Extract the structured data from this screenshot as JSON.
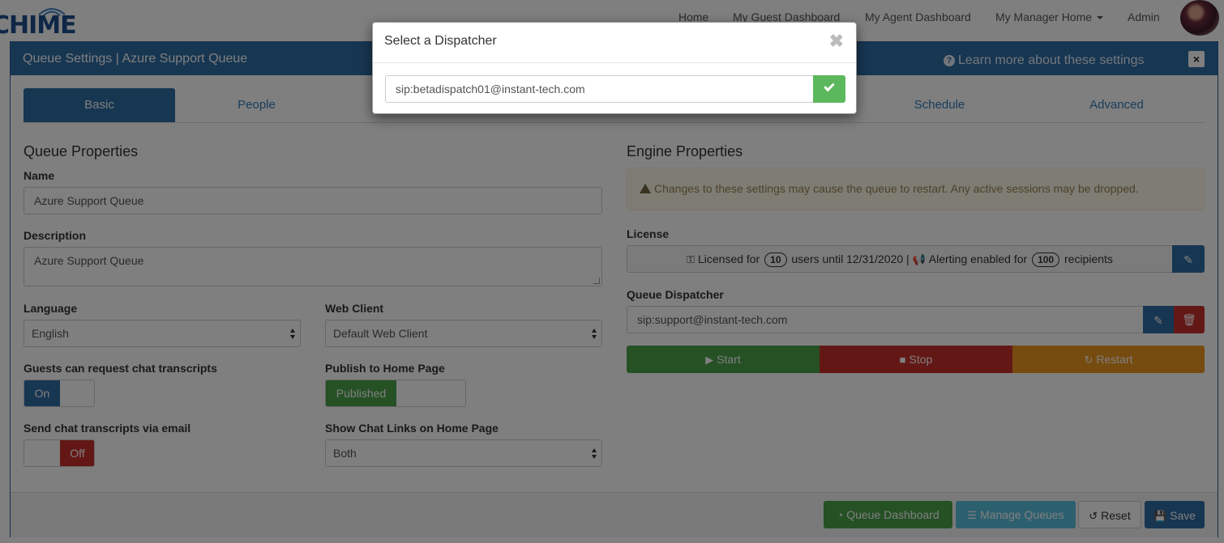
{
  "brand": {
    "logo_text": "CHIME"
  },
  "nav": {
    "links": [
      "Home",
      "My Guest Dashboard",
      "My Agent Dashboard",
      "My Manager Home",
      "Admin"
    ]
  },
  "panel": {
    "title": "Queue Settings | Azure Support Queue",
    "learn_more": "Learn more about these settings",
    "close": "×"
  },
  "tabs": [
    "Basic",
    "People",
    "Schedule",
    "Advanced"
  ],
  "queue": {
    "section_title": "Queue Properties",
    "name_label": "Name",
    "name_value": "Azure Support Queue",
    "description_label": "Description",
    "description_value": "Azure Support Queue",
    "language_label": "Language",
    "language_value": "English",
    "web_client_label": "Web Client",
    "web_client_value": "Default Web Client",
    "transcripts_label": "Guests can request chat transcripts",
    "transcripts_value": "On",
    "publish_label": "Publish to Home Page",
    "publish_value": "Published",
    "email_label": "Send chat transcripts via email",
    "email_value": "Off",
    "chat_links_label": "Show Chat Links on Home Page",
    "chat_links_value": "Both"
  },
  "engine": {
    "section_title": "Engine Properties",
    "warning": "Changes to these settings may cause the queue to restart. Any active sessions may be dropped.",
    "license_label": "License",
    "license_prefix": "Licensed for",
    "license_users": "10",
    "license_mid": "users until 12/31/2020 |",
    "license_alert": "Alerting enabled for",
    "license_recipients": "100",
    "license_suffix": "recipients",
    "dispatcher_label": "Queue Dispatcher",
    "dispatcher_value": "sip:support@instant-tech.com",
    "start": "Start",
    "stop": "Stop",
    "restart": "Restart"
  },
  "footer": {
    "dashboard": "Queue Dashboard",
    "manage": "Manage Queues",
    "reset": "Reset",
    "save": "Save"
  },
  "modal": {
    "title": "Select a Dispatcher",
    "input_value": "sip:betadispatch01@instant-tech.com",
    "close": "✖"
  },
  "colors": {
    "primary": "#2e6da4",
    "success": "#4aa34a",
    "danger": "#c9302c",
    "warning": "#ec971f",
    "info": "#5bc0de"
  }
}
